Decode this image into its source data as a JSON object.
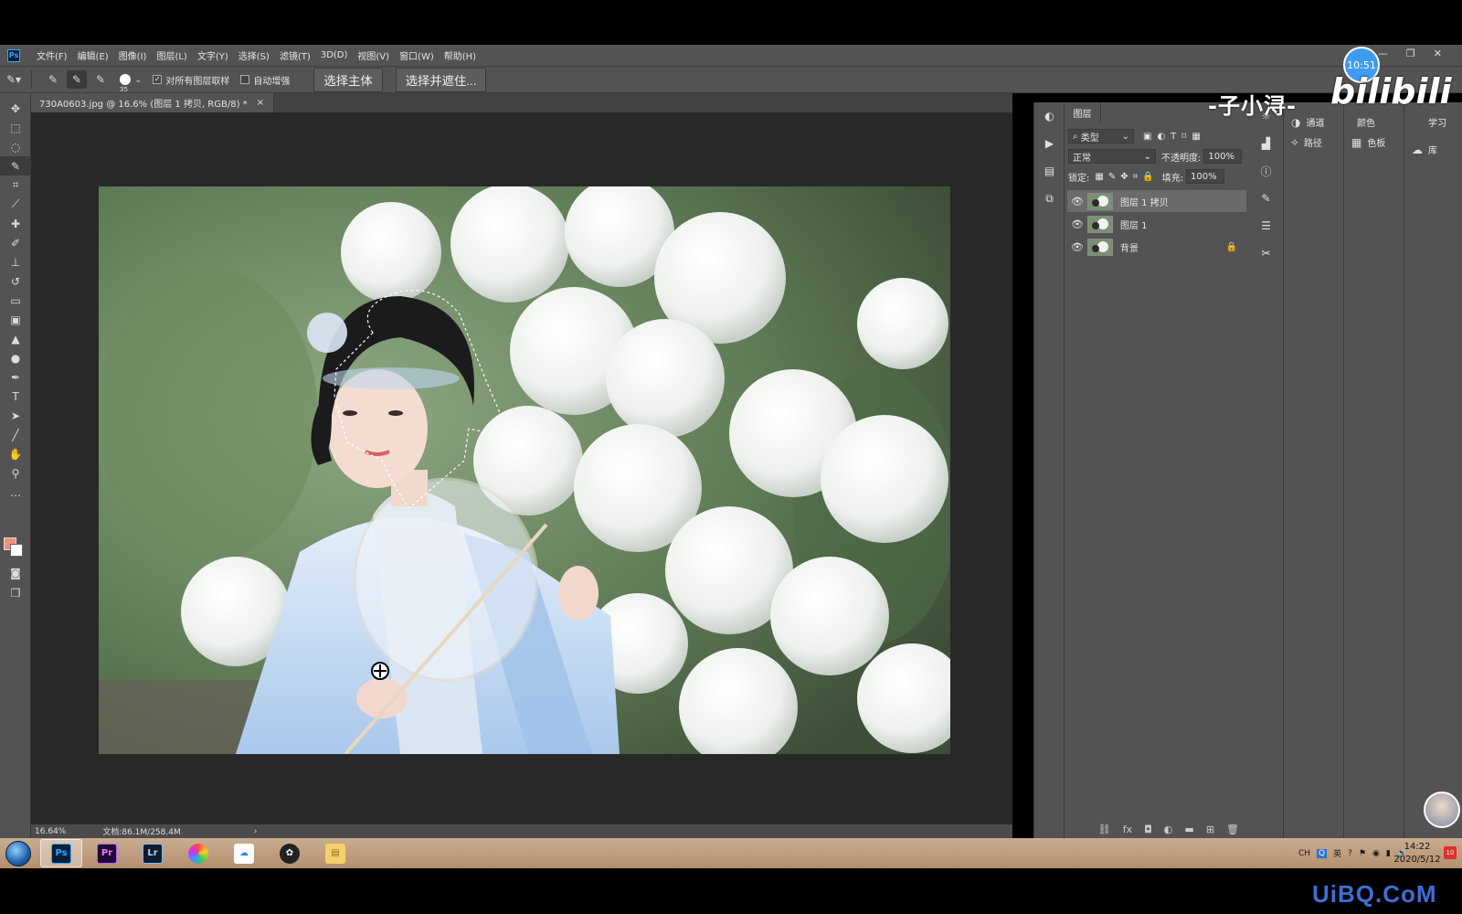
{
  "window": {
    "app_logo": "Ps",
    "menu": [
      "文件(F)",
      "编辑(E)",
      "图像(I)",
      "图层(L)",
      "文字(Y)",
      "选择(S)",
      "滤镜(T)",
      "3D(D)",
      "视图(V)",
      "窗口(W)",
      "帮助(H)"
    ],
    "controls": {
      "minimize": "—",
      "restore": "❐",
      "close": "✕"
    }
  },
  "options_bar": {
    "brush_size": "35",
    "sample_all_layers": {
      "label": "对所有图层取样",
      "checked": true
    },
    "auto_enhance": {
      "label": "自动增强",
      "checked": false
    },
    "select_subject": "选择主体",
    "select_and_mask": "选择并遮住..."
  },
  "document": {
    "tab_title": "730A0603.jpg @ 16.6% (图层 1 拷贝, RGB/8) *",
    "tab_close": "×",
    "zoom": "16.64%",
    "doc_size": "文档:86.1M/258.4M",
    "status_arrow": "›"
  },
  "layers_panel": {
    "tab": "图层",
    "filter_kind": "类型",
    "blend_mode": "正常",
    "opacity_label": "不透明度:",
    "opacity_value": "100%",
    "lock_label": "锁定:",
    "fill_label": "填充:",
    "fill_value": "100%",
    "layers": [
      {
        "name": "图层 1 拷贝",
        "selected": true,
        "locked": false
      },
      {
        "name": "图层 1",
        "selected": false,
        "locked": false
      },
      {
        "name": "背景",
        "selected": false,
        "locked": true
      }
    ]
  },
  "right_panels": {
    "channels": "通道",
    "paths": "路径",
    "color": "颜色",
    "swatches": "色板",
    "learn": "学习",
    "libraries": "库"
  },
  "overlay": {
    "clock": "10:51",
    "watermark_text": "-子小浔-",
    "watermark_logo": "bilibili",
    "site_watermark": "UiBQ.CoM"
  },
  "taskbar": {
    "apps": [
      {
        "label": "Ps",
        "bg": "#0a1f3a",
        "fg": "#31a8ff",
        "active": true
      },
      {
        "label": "Pr",
        "bg": "#1f0a36",
        "fg": "#e77cff",
        "active": false
      },
      {
        "label": "Lr",
        "bg": "#0f1d2c",
        "fg": "#aed6ff",
        "active": false
      }
    ],
    "tray": {
      "lang1": "CH",
      "lang2": "英"
    },
    "time": "14:22",
    "date": "2020/5/12",
    "notifications": "10"
  }
}
